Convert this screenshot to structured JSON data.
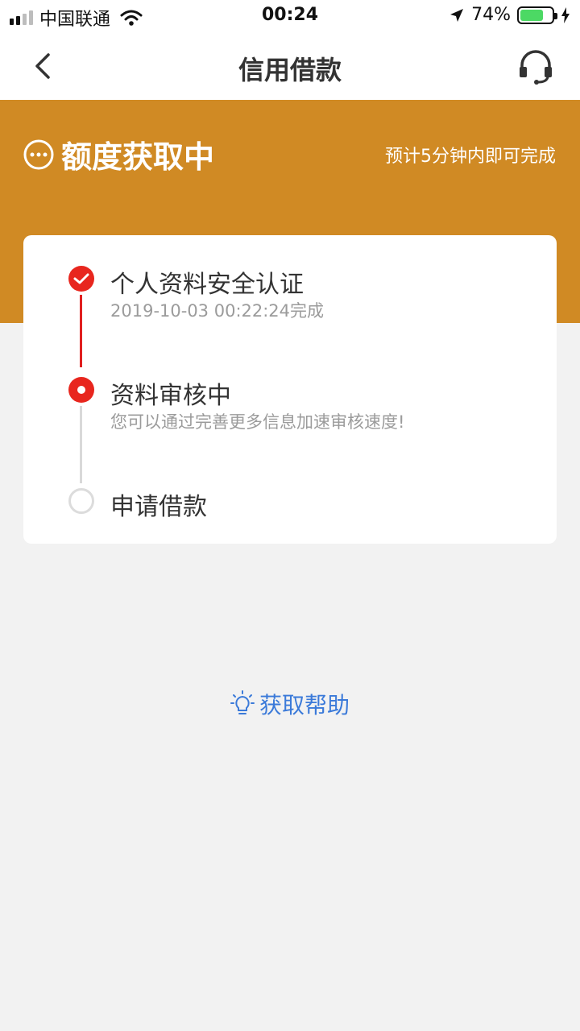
{
  "status_bar": {
    "carrier": "中国联通",
    "time": "00:24",
    "battery_percent": "74%",
    "battery_level": 0.74
  },
  "nav": {
    "title": "信用借款",
    "back_icon": "chevron-left-icon",
    "service_icon": "headset-icon"
  },
  "hero": {
    "status_icon": "ellipsis-circle-icon",
    "status_text": "额度获取中",
    "hint": "预计5分钟内即可完成",
    "color": "#d08a24"
  },
  "steps": [
    {
      "title": "个人资料安全认证",
      "subtitle": "2019-10-03 00:22:24完成",
      "state": "done",
      "icon": "check-circle-icon"
    },
    {
      "title": "资料审核中",
      "subtitle": "您可以通过完善更多信息加速审核速度!",
      "state": "current",
      "icon": "dot-circle-icon"
    },
    {
      "title": "申请借款",
      "subtitle": "",
      "state": "pending",
      "icon": "empty-circle-icon"
    }
  ],
  "help": {
    "icon": "lightbulb-icon",
    "label": "获取帮助",
    "color": "#3b7ad9"
  },
  "colors": {
    "accent_red": "#e8261e",
    "background": "#f2f2f2"
  }
}
